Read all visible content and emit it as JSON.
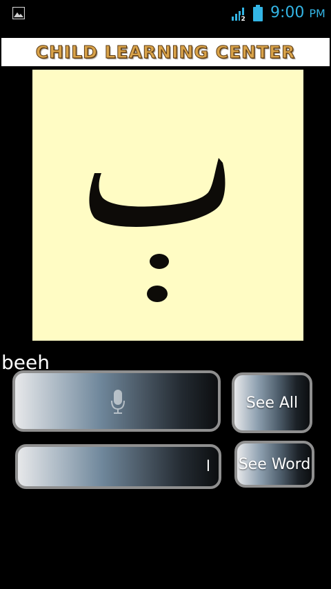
{
  "status_bar": {
    "time": "9:00",
    "ampm": "PM",
    "network_badge": "2",
    "time_color": "#33b5e5",
    "icons": [
      "gallery-notification-icon",
      "signal-icon",
      "battery-icon"
    ]
  },
  "banner": {
    "title": "CHILD LEARNING CENTER",
    "title_color": "#d9a34a"
  },
  "letter": {
    "glyph": "ب",
    "name": "beeh",
    "card_color": "#fffcc4"
  },
  "controls": {
    "mic_icon": "microphone-icon",
    "text_field_value": "ا",
    "see_all_label": "See All",
    "see_word_label": "See Word"
  }
}
